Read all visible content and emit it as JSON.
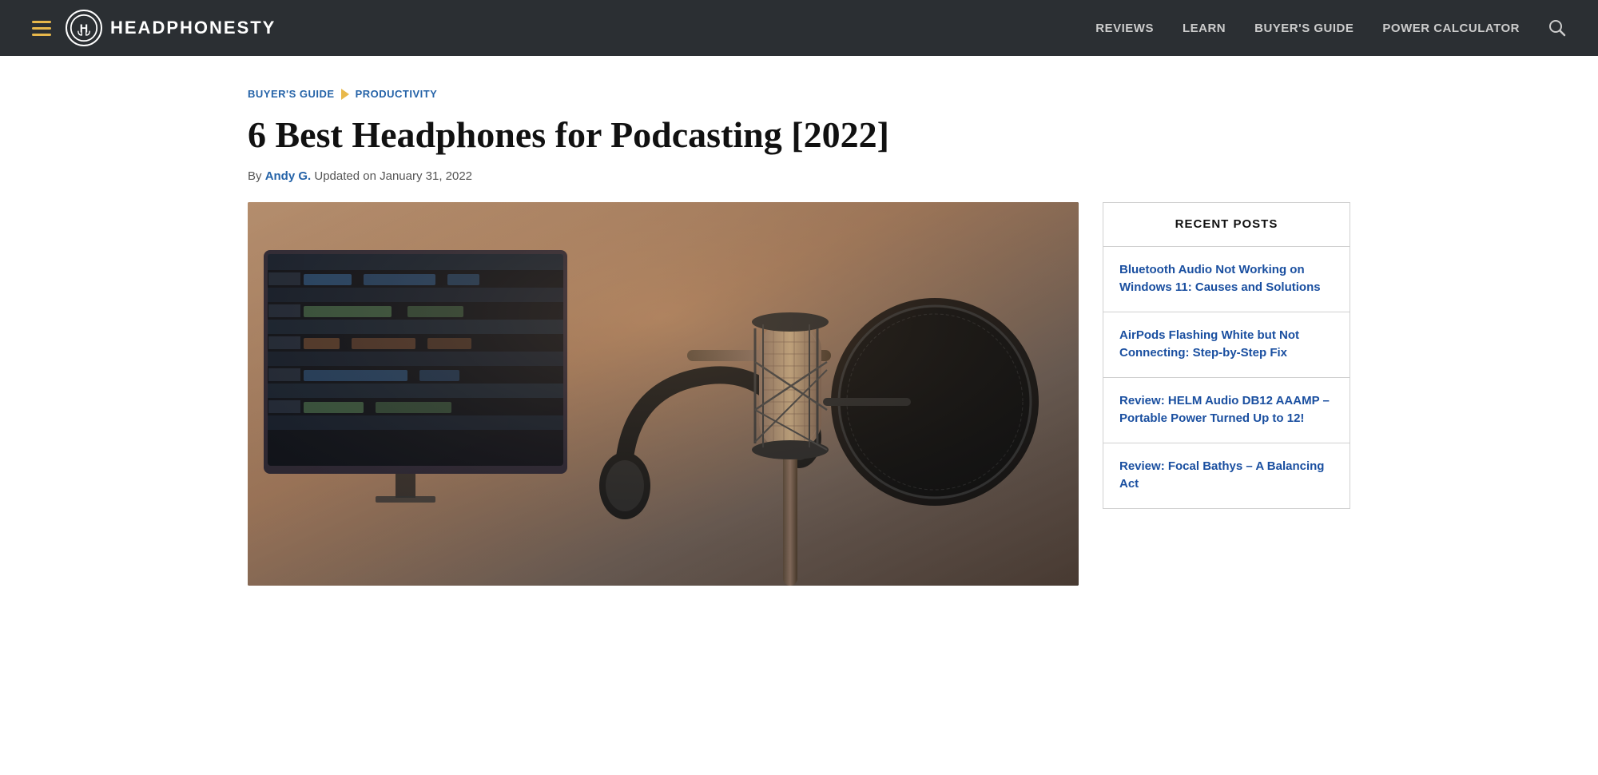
{
  "header": {
    "logo_text": "HEADPHONESTY",
    "nav_items": [
      {
        "label": "REVIEWS",
        "href": "#"
      },
      {
        "label": "LEARN",
        "href": "#"
      },
      {
        "label": "BUYER'S GUIDE",
        "href": "#"
      },
      {
        "label": "POWER CALCULATOR",
        "href": "#"
      }
    ]
  },
  "breadcrumb": {
    "parent": "BUYER'S GUIDE",
    "current": "PRODUCTIVITY"
  },
  "article": {
    "title": "6 Best Headphones for Podcasting [2022]",
    "author_prefix": "By ",
    "author_name": "Andy G.",
    "author_suffix": "  Updated on January 31, 2022"
  },
  "sidebar": {
    "recent_posts_heading": "RECENT POSTS",
    "posts": [
      {
        "title": "Bluetooth Audio Not Working on Windows 11: Causes and Solutions"
      },
      {
        "title": "AirPods Flashing White but Not Connecting: Step-by-Step Fix"
      },
      {
        "title": "Review: HELM Audio DB12 AAAMP – Portable Power Turned Up to 12!"
      },
      {
        "title": "Review: Focal Bathys – A Balancing Act"
      }
    ]
  }
}
